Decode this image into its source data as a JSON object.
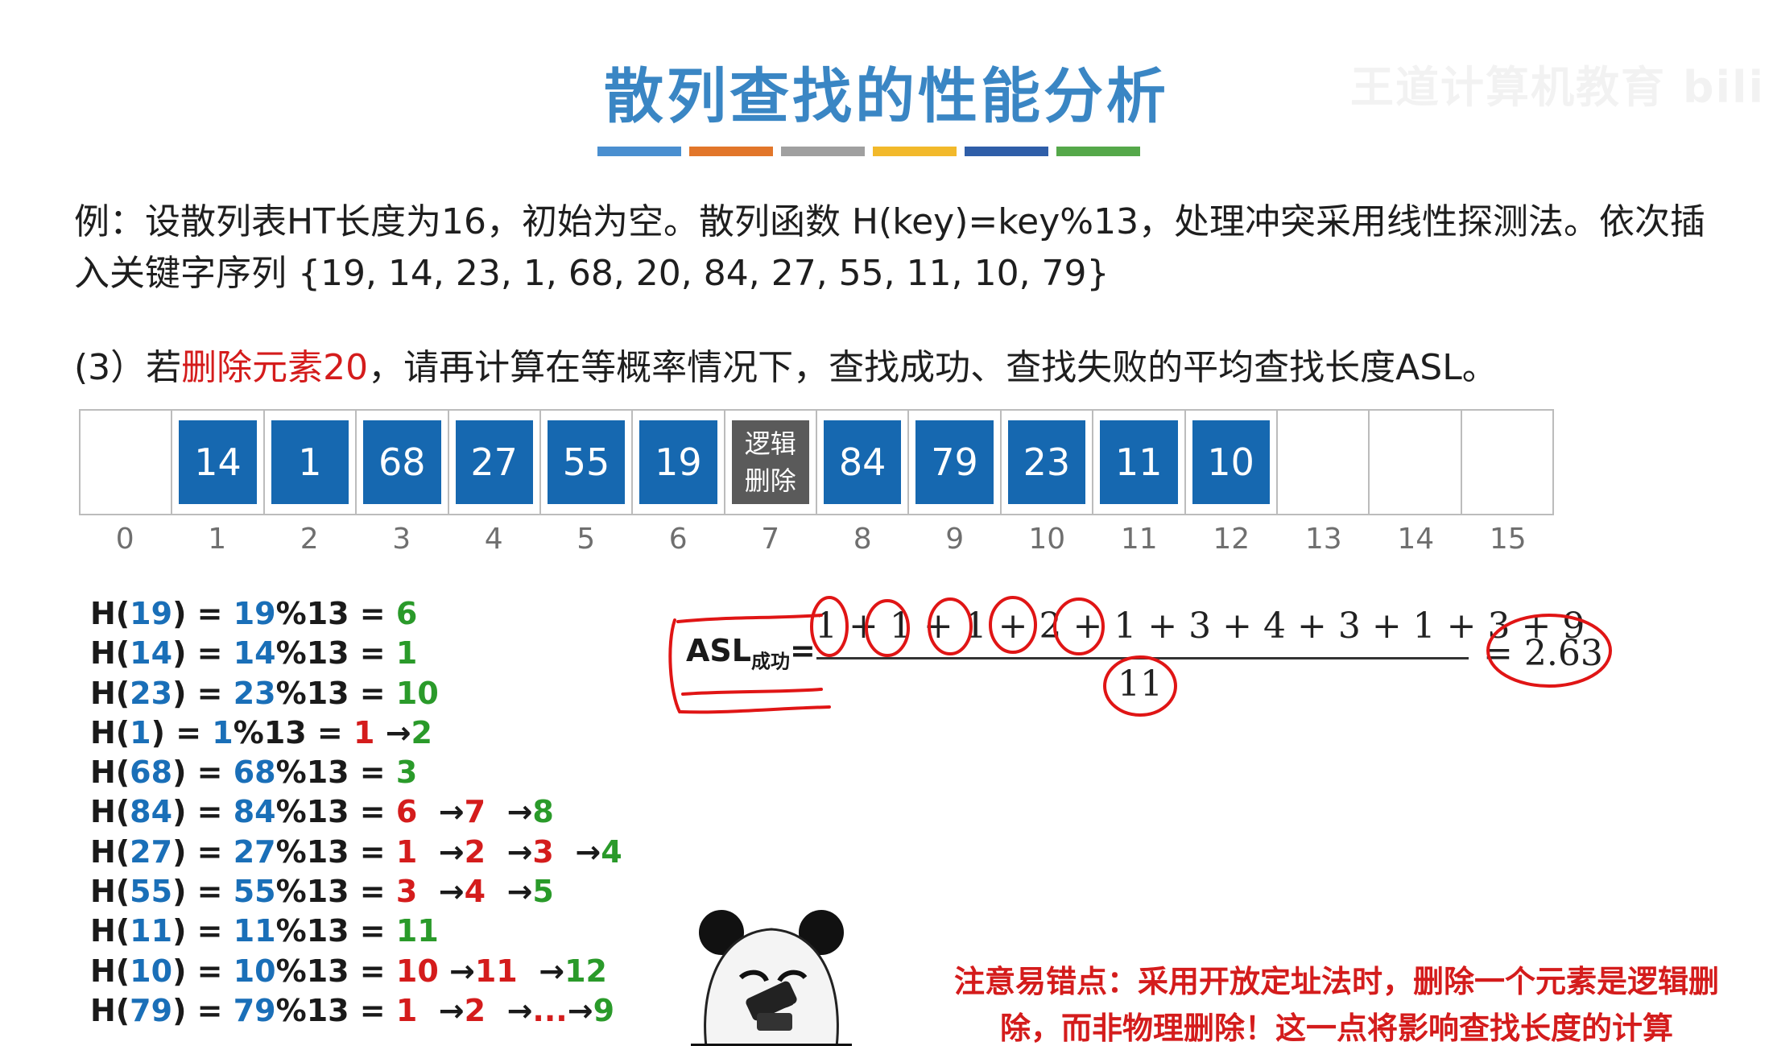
{
  "title": "散列查找的性能分析",
  "title_bar_colors": [
    "#4a8fd0",
    "#e2762a",
    "#a0a0a0",
    "#f2b92b",
    "#2f5ea8",
    "#55a84a"
  ],
  "watermark": "王道计算机教育 bili",
  "problem_line1": "例：设散列表HT长度为16，初始为空。散列函数 H(key)=key%13，处理冲突采用线性探测法。依次插",
  "problem_line2": "入关键字序列 {19, 14, 23, 1, 68, 20, 84, 27, 55, 11, 10, 79}",
  "question": {
    "prefix": "(3）若",
    "highlight": "删除元素20",
    "suffix": "，请再计算在等概率情况下，查找成功、查找失败的平均查找长度ASL。"
  },
  "table": {
    "cells": [
      "",
      "14",
      "1",
      "68",
      "27",
      "55",
      "19",
      "逻辑删除",
      "84",
      "79",
      "23",
      "11",
      "10",
      "",
      "",
      ""
    ],
    "indices": [
      "0",
      "1",
      "2",
      "3",
      "4",
      "5",
      "6",
      "7",
      "8",
      "9",
      "10",
      "11",
      "12",
      "13",
      "14",
      "15"
    ],
    "deleted_cell": {
      "line1": "逻辑",
      "line2": "删除"
    }
  },
  "calcs": [
    {
      "head": "H(",
      "key": "19",
      "mid1": ") = ",
      "key2": "19",
      "mod": "%13 = ",
      "steps": [
        {
          "v": "6",
          "c": "green"
        }
      ]
    },
    {
      "head": "H(",
      "key": "14",
      "mid1": ") = ",
      "key2": "14",
      "mod": "%13 = ",
      "steps": [
        {
          "v": "1",
          "c": "green"
        }
      ]
    },
    {
      "head": "H(",
      "key": "23",
      "mid1": ") = ",
      "key2": "23",
      "mod": "%13 = ",
      "steps": [
        {
          "v": "10",
          "c": "green"
        }
      ]
    },
    {
      "head": "H(",
      "key": "1",
      "mid1": ") = ",
      "key2": "1",
      "mod": "%13 = ",
      "steps": [
        {
          "v": "1",
          "c": "red"
        },
        {
          "v": " →",
          "c": "plain"
        },
        {
          "v": "2",
          "c": "green"
        }
      ]
    },
    {
      "head": "H(",
      "key": "68",
      "mid1": ") = ",
      "key2": "68",
      "mod": "%13 = ",
      "steps": [
        {
          "v": "3",
          "c": "green"
        }
      ]
    },
    {
      "head": "H(",
      "key": "84",
      "mid1": ") = ",
      "key2": "84",
      "mod": "%13 = ",
      "steps": [
        {
          "v": "6",
          "c": "red"
        },
        {
          "v": "  →",
          "c": "plain"
        },
        {
          "v": "7",
          "c": "red"
        },
        {
          "v": "  →",
          "c": "plain"
        },
        {
          "v": "8",
          "c": "green"
        }
      ]
    },
    {
      "head": "H(",
      "key": "27",
      "mid1": ") = ",
      "key2": "27",
      "mod": "%13 = ",
      "steps": [
        {
          "v": "1",
          "c": "red"
        },
        {
          "v": "  →",
          "c": "plain"
        },
        {
          "v": "2",
          "c": "red"
        },
        {
          "v": "  →",
          "c": "plain"
        },
        {
          "v": "3",
          "c": "red"
        },
        {
          "v": "  →",
          "c": "plain"
        },
        {
          "v": "4",
          "c": "green"
        }
      ]
    },
    {
      "head": "H(",
      "key": "55",
      "mid1": ") = ",
      "key2": "55",
      "mod": "%13 = ",
      "steps": [
        {
          "v": "3",
          "c": "red"
        },
        {
          "v": "  →",
          "c": "plain"
        },
        {
          "v": "4",
          "c": "red"
        },
        {
          "v": "  →",
          "c": "plain"
        },
        {
          "v": "5",
          "c": "green"
        }
      ]
    },
    {
      "head": "H(",
      "key": "11",
      "mid1": ") = ",
      "key2": "11",
      "mod": "%13 = ",
      "steps": [
        {
          "v": "11",
          "c": "green"
        }
      ]
    },
    {
      "head": "H(",
      "key": "10",
      "mid1": ") = ",
      "key2": "10",
      "mod": "%13 = ",
      "steps": [
        {
          "v": "10",
          "c": "red"
        },
        {
          "v": " →",
          "c": "plain"
        },
        {
          "v": "11",
          "c": "red"
        },
        {
          "v": "  →",
          "c": "plain"
        },
        {
          "v": "12",
          "c": "green"
        }
      ]
    },
    {
      "head": "H(",
      "key": "79",
      "mid1": ") = ",
      "key2": "79",
      "mod": "%13 = ",
      "steps": [
        {
          "v": "1",
          "c": "red"
        },
        {
          "v": "  →",
          "c": "plain"
        },
        {
          "v": "2",
          "c": "red"
        },
        {
          "v": "  →",
          "c": "plain"
        },
        {
          "v": "...",
          "c": "red"
        },
        {
          "v": "→",
          "c": "plain"
        },
        {
          "v": "9",
          "c": "green"
        }
      ]
    }
  ],
  "asl": {
    "label": "ASL",
    "sub": "成功",
    "eq": "=",
    "numerator": "1 + 1 + 1 + 2 + 1 + 3 + 4 + 3 + 1 + 3 + 9",
    "denominator": "11",
    "result_eq": "=",
    "result": "2.63"
  },
  "note": {
    "line1": "注意易错点：采用开放定址法时，删除一个元素是逻辑删",
    "line2": "除，而非物理删除！这一点将影响查找长度的计算"
  },
  "colors": {
    "title": "#3a86c4",
    "cell_blue": "#1668b0",
    "cell_gray": "#5a5a5a",
    "key_blue": "#1a6fb8",
    "red": "#d41c1c",
    "green": "#2a9a2a"
  }
}
